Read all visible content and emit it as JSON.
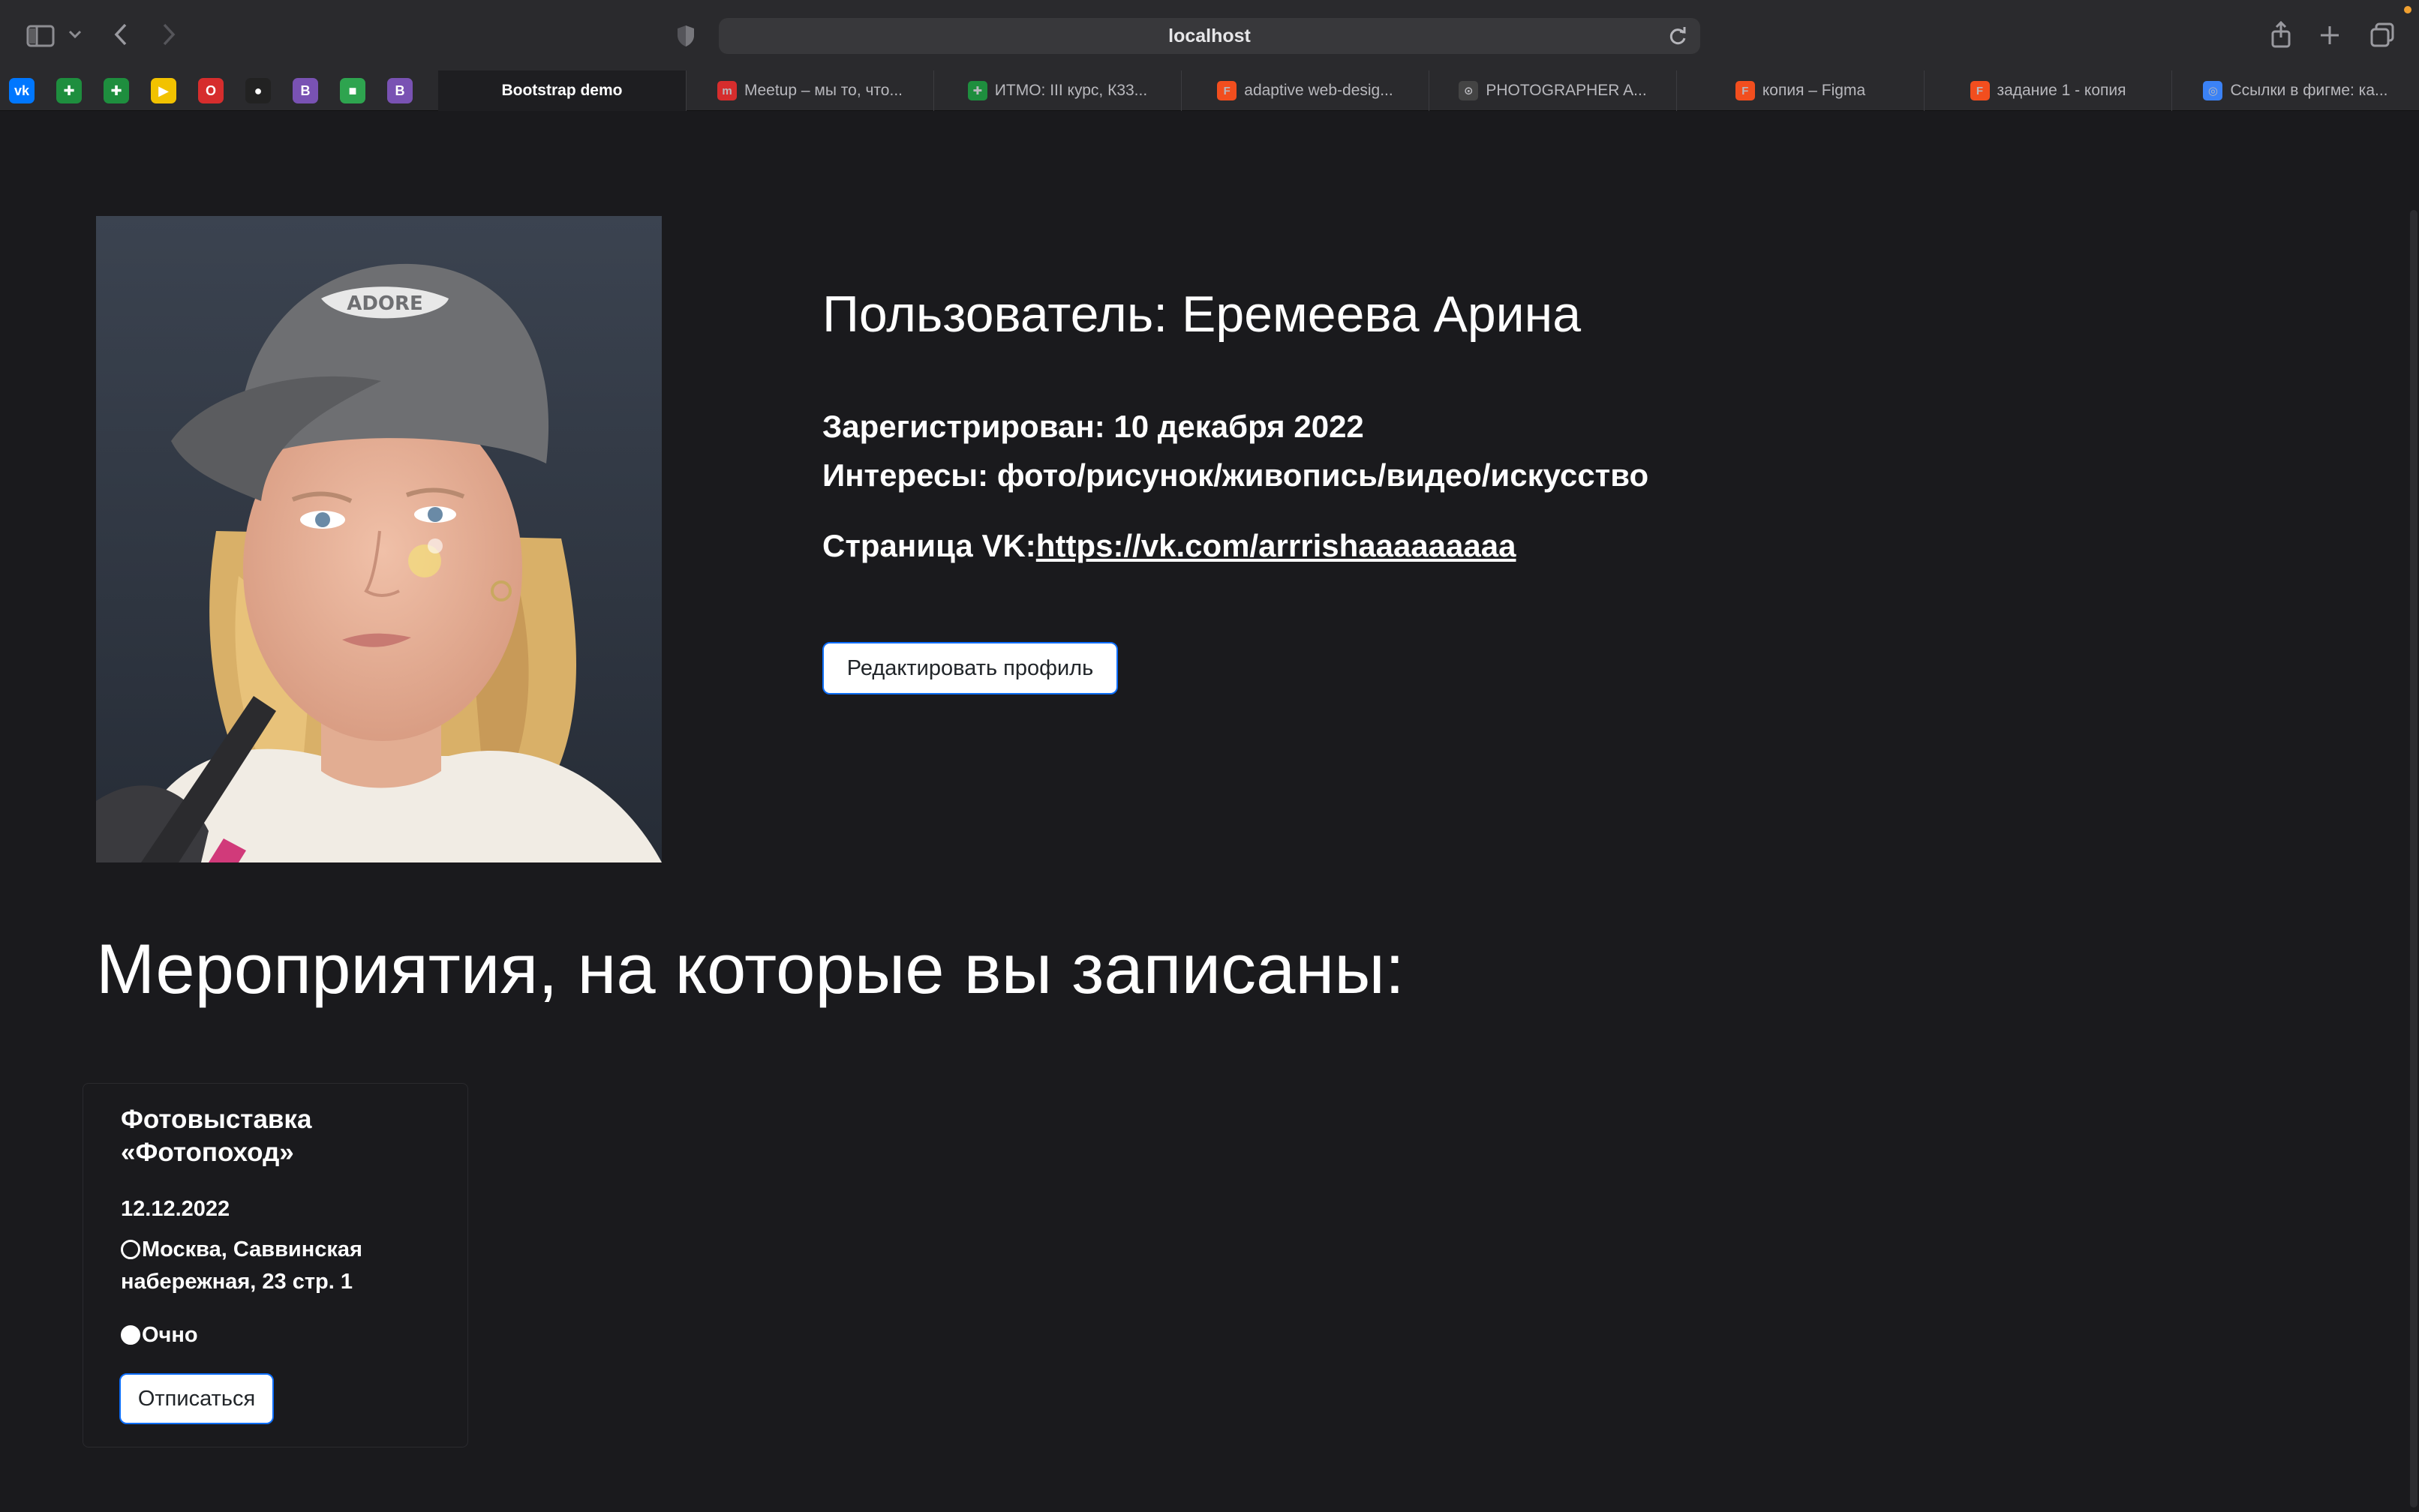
{
  "browser": {
    "url": "localhost",
    "tabs": [
      {
        "label": "Bootstrap demo",
        "active": true
      },
      {
        "label": "Meetup – мы то, что...",
        "active": false
      },
      {
        "label": "ИТМО: III курс, К33...",
        "active": false
      },
      {
        "label": "adaptive web-desig...",
        "active": false
      },
      {
        "label": "PHOTOGRAPHER A...",
        "active": false
      },
      {
        "label": "копия – Figma",
        "active": false
      },
      {
        "label": "задание 1 - копия",
        "active": false
      },
      {
        "label": "Ссылки в фигме: ка...",
        "active": false
      }
    ],
    "favorites": [
      {
        "icon": "vk-icon",
        "glyph": "vk",
        "color": "#0077ff"
      },
      {
        "icon": "sheets-icon",
        "glyph": "✚",
        "color": "#1e8e3e"
      },
      {
        "icon": "sheets-icon",
        "glyph": "✚",
        "color": "#1e8e3e"
      },
      {
        "icon": "youtube-icon",
        "glyph": "▶",
        "color": "#f2c200"
      },
      {
        "icon": "opera-icon",
        "glyph": "O",
        "color": "#d62d2d"
      },
      {
        "icon": "github-icon",
        "glyph": "●",
        "color": "#222222"
      },
      {
        "icon": "bootstrap-icon",
        "glyph": "B",
        "color": "#7952b3"
      },
      {
        "icon": "green-app-icon",
        "glyph": "■",
        "color": "#2ea44f"
      },
      {
        "icon": "bootstrap-icon",
        "glyph": "B",
        "color": "#7952b3"
      }
    ]
  },
  "profile": {
    "title": "Пользователь: Еремеева Арина",
    "registered": "Зарегистрирован: 10 декабря 2022",
    "interests": "Интересы: фото/рисунок/живопись/видео/искусство",
    "vk_label": "Страница VK:",
    "vk_link": "https://vk.com/arrrishaaaaaaaaa",
    "edit_button": "Редактировать профиль",
    "cap_text": "ADORE"
  },
  "events": {
    "heading": "Мероприятия, на которые вы записаны:",
    "items": [
      {
        "title": "Фотовыставка «Фотопоход»",
        "date": "12.12.2022",
        "address_line1": "Москва, Саввинская",
        "address_line2": "набережная, 23 стр. 1",
        "format": "Очно",
        "unsubscribe": "Отписаться"
      }
    ]
  },
  "colors": {
    "page_bg": "#1a1a1d",
    "accent_border": "#0d6efd",
    "chrome_bg": "#2a2a2d"
  }
}
